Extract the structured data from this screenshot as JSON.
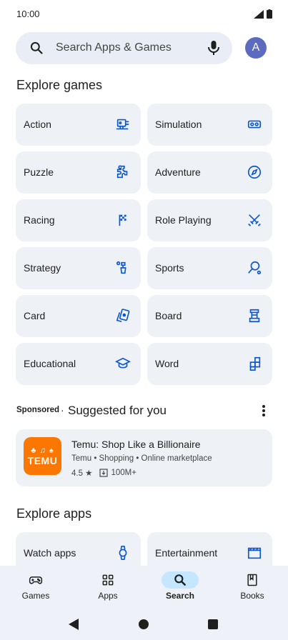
{
  "status": {
    "time": "10:00"
  },
  "search": {
    "placeholder": "Search Apps & Games"
  },
  "account": {
    "initial": "A"
  },
  "explore_games": {
    "title": "Explore games",
    "categories": [
      {
        "label": "Action",
        "icon": "gamepad-sword-icon"
      },
      {
        "label": "Simulation",
        "icon": "vr-headset-icon"
      },
      {
        "label": "Puzzle",
        "icon": "puzzle-piece-icon"
      },
      {
        "label": "Adventure",
        "icon": "compass-icon"
      },
      {
        "label": "Racing",
        "icon": "checkered-flag-icon"
      },
      {
        "label": "Role Playing",
        "icon": "crossed-swords-icon"
      },
      {
        "label": "Strategy",
        "icon": "strategy-icon"
      },
      {
        "label": "Sports",
        "icon": "racket-icon"
      },
      {
        "label": "Card",
        "icon": "playing-cards-icon"
      },
      {
        "label": "Board",
        "icon": "chess-rook-icon"
      },
      {
        "label": "Educational",
        "icon": "graduation-cap-icon"
      },
      {
        "label": "Word",
        "icon": "word-blocks-icon"
      }
    ]
  },
  "suggested": {
    "sponsored_label": "Sponsored",
    "separator": "·",
    "title": "Suggested for you",
    "app": {
      "icon_glyphs": "♣ ♫ ♠",
      "icon_word": "TEMU",
      "name": "Temu: Shop Like a Billionaire",
      "meta": "Temu • Shopping • Online marketplace",
      "rating": "4.5 ★",
      "downloads": "100M+"
    }
  },
  "explore_apps": {
    "title": "Explore apps",
    "categories": [
      {
        "label": "Watch apps",
        "icon": "watch-icon"
      },
      {
        "label": "Entertainment",
        "icon": "clapperboard-icon"
      }
    ]
  },
  "bottom_nav": {
    "items": [
      {
        "label": "Games",
        "icon": "gamepad-icon",
        "active": false
      },
      {
        "label": "Apps",
        "icon": "apps-grid-icon",
        "active": false
      },
      {
        "label": "Search",
        "icon": "search-icon",
        "active": true
      },
      {
        "label": "Books",
        "icon": "book-icon",
        "active": false
      }
    ]
  },
  "colors": {
    "accent_blue": "#0b57d0",
    "tile_bg": "#eef1f6",
    "nav_active_pill": "#c4e7ff",
    "temu_orange": "#fb7701",
    "avatar": "#5c6bc0"
  }
}
